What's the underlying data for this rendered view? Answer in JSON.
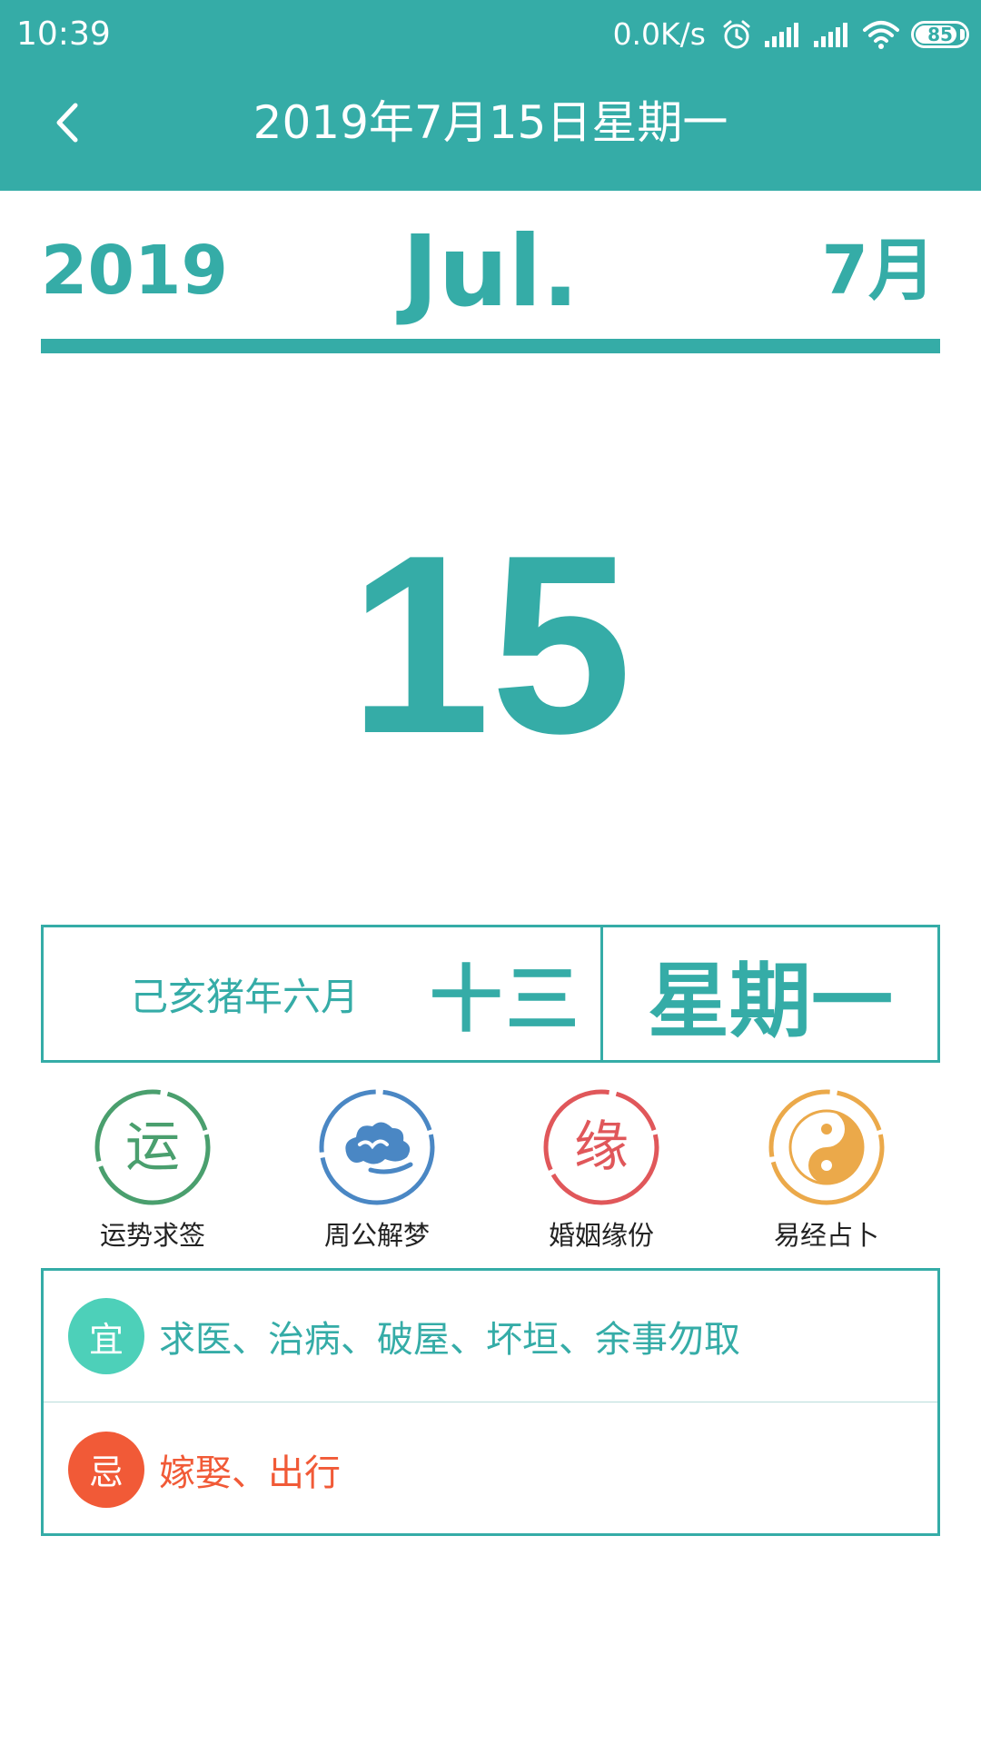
{
  "status_bar": {
    "time": "10:39",
    "net_speed": "0.0K/s",
    "battery_level": "85",
    "battery_fraction": 0.85,
    "icons": [
      "alarm-icon",
      "signal-icon",
      "signal-icon",
      "wifi-icon",
      "battery-icon"
    ]
  },
  "header": {
    "back_icon": "chevron-left-icon",
    "title": "2019年7月15日星期一"
  },
  "month_header": {
    "year": "2019",
    "month_en": "Jul.",
    "month_cn": "7月"
  },
  "day": "15",
  "lunar": {
    "year_month": "己亥猪年六月",
    "day": "十三",
    "weekday": "星期一"
  },
  "features": [
    {
      "label": "运势求签",
      "glyph": "运",
      "color": "#4a9f6e",
      "icon": "fortune-icon"
    },
    {
      "label": "周公解梦",
      "color": "#4a87c4",
      "icon": "cloud-dream-icon"
    },
    {
      "label": "婚姻缘份",
      "glyph": "缘",
      "color": "#e0575a",
      "icon": "marriage-icon"
    },
    {
      "label": "易经占卜",
      "color": "#eba94a",
      "icon": "yin-yang-icon"
    }
  ],
  "almanac": {
    "yi": {
      "badge": "宜",
      "text": "求医、治病、破屋、坏垣、余事勿取",
      "color": "#4dd0b9"
    },
    "ji": {
      "badge": "忌",
      "text": "嫁娶、出行",
      "color": "#f15a37"
    }
  },
  "colors": {
    "primary": "#35aca7",
    "yi_text": "#35aca7",
    "ji_text": "#f15a37"
  }
}
